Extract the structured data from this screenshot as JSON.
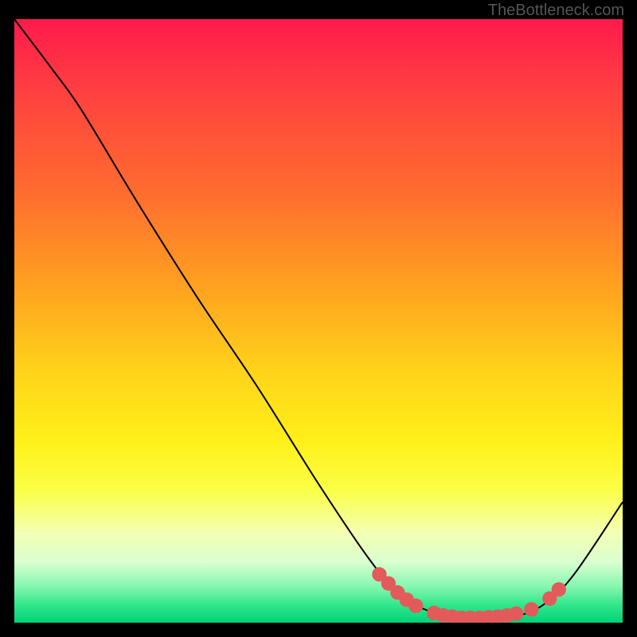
{
  "watermark": "TheBottleneck.com",
  "chart_data": {
    "type": "line",
    "title": "",
    "xlabel": "",
    "ylabel": "",
    "xlim": [
      0,
      100
    ],
    "ylim": [
      0,
      100
    ],
    "curve": {
      "name": "bottleneck-curve",
      "points": [
        {
          "x": 0,
          "y": 100
        },
        {
          "x": 6,
          "y": 92
        },
        {
          "x": 11,
          "y": 85
        },
        {
          "x": 20,
          "y": 70
        },
        {
          "x": 30,
          "y": 54
        },
        {
          "x": 40,
          "y": 39
        },
        {
          "x": 50,
          "y": 23
        },
        {
          "x": 58,
          "y": 11
        },
        {
          "x": 63,
          "y": 5
        },
        {
          "x": 68,
          "y": 2
        },
        {
          "x": 75,
          "y": 0.8
        },
        {
          "x": 82,
          "y": 1
        },
        {
          "x": 87,
          "y": 3
        },
        {
          "x": 92,
          "y": 8
        },
        {
          "x": 100,
          "y": 20
        }
      ]
    },
    "markers": {
      "name": "highlight-markers",
      "color": "#e35a5a",
      "radius": 1.2,
      "points": [
        {
          "x": 60,
          "y": 8
        },
        {
          "x": 61.5,
          "y": 6.5
        },
        {
          "x": 63,
          "y": 5
        },
        {
          "x": 64.5,
          "y": 3.8
        },
        {
          "x": 66,
          "y": 2.8
        },
        {
          "x": 69,
          "y": 1.6
        },
        {
          "x": 70.5,
          "y": 1.2
        },
        {
          "x": 72,
          "y": 1
        },
        {
          "x": 73.5,
          "y": 0.8
        },
        {
          "x": 75,
          "y": 0.8
        },
        {
          "x": 76.5,
          "y": 0.8
        },
        {
          "x": 78,
          "y": 0.9
        },
        {
          "x": 79.5,
          "y": 1
        },
        {
          "x": 81,
          "y": 1.2
        },
        {
          "x": 82.5,
          "y": 1.5
        },
        {
          "x": 85,
          "y": 2.2
        },
        {
          "x": 88,
          "y": 4
        },
        {
          "x": 89.5,
          "y": 5.5
        }
      ]
    }
  }
}
